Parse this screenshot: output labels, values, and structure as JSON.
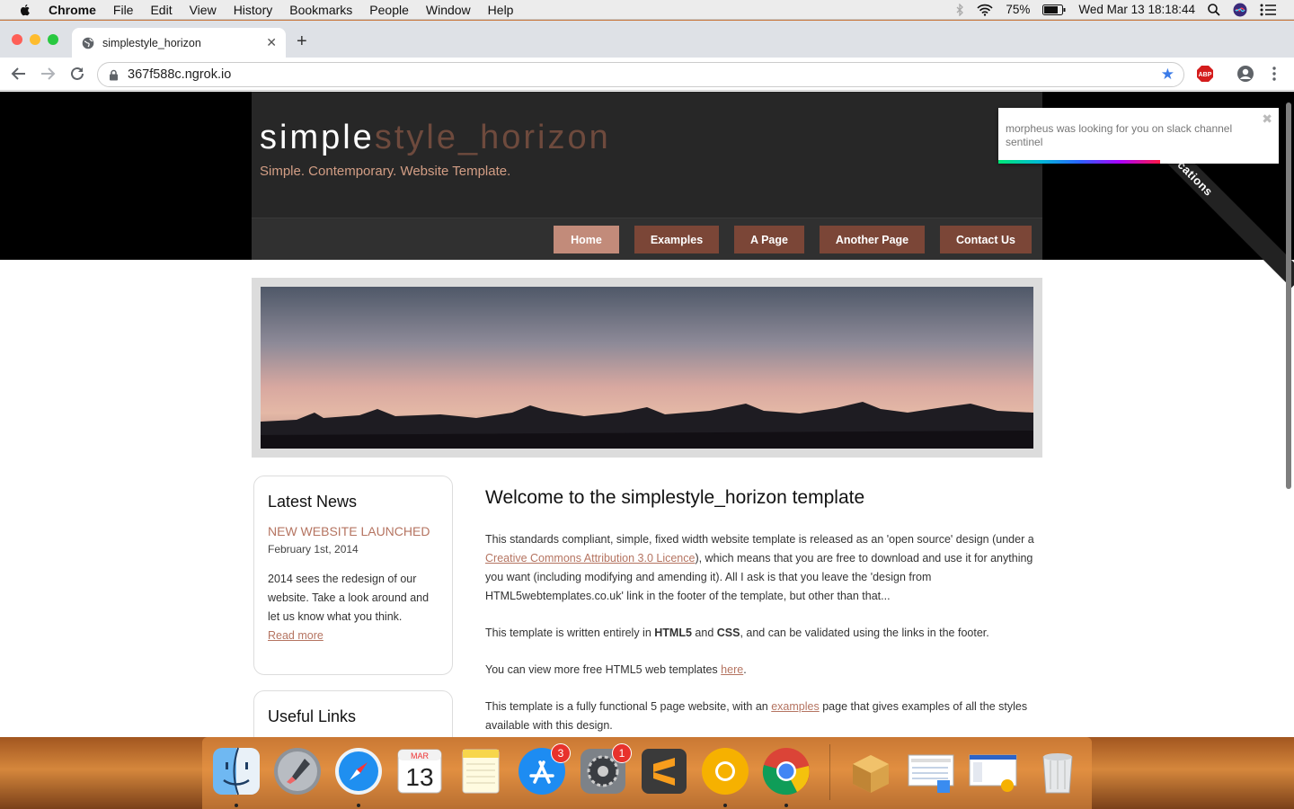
{
  "menubar": {
    "app": "Chrome",
    "items": [
      "File",
      "Edit",
      "View",
      "History",
      "Bookmarks",
      "People",
      "Window",
      "Help"
    ],
    "battery": "75%",
    "clock": "Wed Mar 13  18:18:44"
  },
  "browser": {
    "tab_title": "simplestyle_horizon",
    "url": "367f588c.ngrok.io",
    "ext_label": "ABP"
  },
  "site": {
    "logo_part1": "simple",
    "logo_part2": "style_horizon",
    "slogan": "Simple. Contemporary. Website Template.",
    "nav": [
      "Home",
      "Examples",
      "A Page",
      "Another Page",
      "Contact Us"
    ],
    "selected_nav": "Home"
  },
  "sidebar": {
    "news_heading": "Latest News",
    "news_title": "NEW WEBSITE LAUNCHED",
    "news_date": "February 1st, 2014",
    "news_body": "2014 sees the redesign of our website. Take a look around and let us know what you think.",
    "read_more": "Read more",
    "links_heading": "Useful Links"
  },
  "content": {
    "heading": "Welcome to the simplestyle_horizon template",
    "p1_a": "This standards compliant, simple, fixed width website template is released as an 'open source' design (under a ",
    "p1_link": "Creative Commons Attribution 3.0 Licence",
    "p1_b": "), which means that you are free to download and use it for anything you want (including modifying and amending it). All I ask is that you leave the 'design from HTML5webtemplates.co.uk' link in the footer of the template, but other than that...",
    "p2_a": "This template is written entirely in ",
    "p2_html": "HTML5",
    "p2_and": " and ",
    "p2_css": "CSS",
    "p2_b": ", and can be validated using the links in the footer.",
    "p3_a": "You can view more free HTML5 web templates ",
    "p3_link": "here",
    "p3_b": ".",
    "p4_a": "This template is a fully functional 5 page website, with an ",
    "p4_link": "examples",
    "p4_b": " page that gives examples of all the styles available with this design."
  },
  "notification": {
    "message": "morpheus was looking for you on slack channel sentinel",
    "close": "✖"
  },
  "ribbon": {
    "text": "Re          cations"
  },
  "dock": {
    "calendar_month": "MAR",
    "calendar_day": "13",
    "appstore_badge": "3",
    "prefs_badge": "1"
  },
  "colors": {
    "accent": "#b57461",
    "nav_button": "#7b4637",
    "nav_selected": "#c28b7a",
    "header": "#272727"
  }
}
